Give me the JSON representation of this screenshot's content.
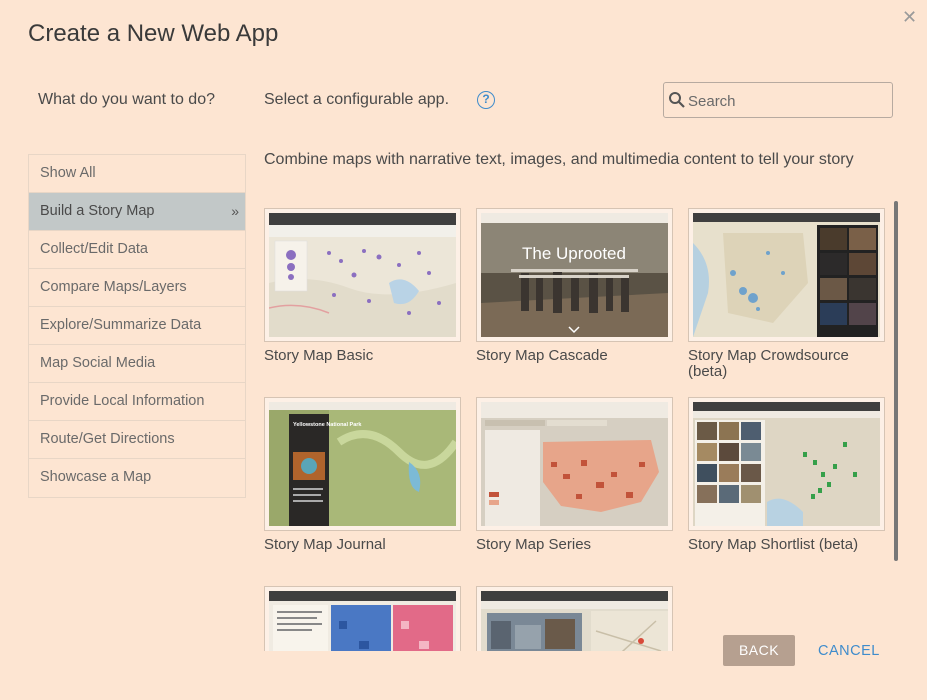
{
  "dialog": {
    "title": "Create a New Web App",
    "close_icon": "close-icon"
  },
  "sidebar": {
    "question": "What do you want to do?",
    "items": [
      {
        "label": "Show All",
        "active": false
      },
      {
        "label": "Build a Story Map",
        "active": true
      },
      {
        "label": "Collect/Edit Data",
        "active": false
      },
      {
        "label": "Compare Maps/Layers",
        "active": false
      },
      {
        "label": "Explore/Summarize Data",
        "active": false
      },
      {
        "label": "Map Social Media",
        "active": false
      },
      {
        "label": "Provide Local Information",
        "active": false
      },
      {
        "label": "Route/Get Directions",
        "active": false
      },
      {
        "label": "Showcase a Map",
        "active": false
      }
    ],
    "active_chevron": "»"
  },
  "main": {
    "select_label": "Select a configurable app.",
    "help_icon": "?",
    "search": {
      "placeholder": "Search",
      "value": ""
    },
    "description": "Combine maps with narrative text, images, and multimedia content to tell your story",
    "apps": [
      {
        "label": "Story Map Basic"
      },
      {
        "label": "Story Map Cascade",
        "thumb_text": "The Uprooted"
      },
      {
        "label": "Story Map Crowdsource (beta)"
      },
      {
        "label": "Story Map Journal",
        "thumb_text": "Yellowstone National Park"
      },
      {
        "label": "Story Map Series"
      },
      {
        "label": "Story Map Shortlist (beta)"
      },
      {
        "label": ""
      },
      {
        "label": ""
      }
    ]
  },
  "footer": {
    "back_label": "BACK",
    "cancel_label": "CANCEL"
  },
  "colors": {
    "background": "#fde5d2",
    "accent": "#3f8ccc",
    "active_item": "#c2c8c8",
    "back_button": "#b6a090"
  }
}
